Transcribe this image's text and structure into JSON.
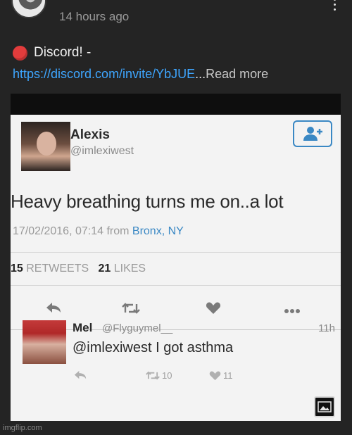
{
  "header": {
    "timestamp": "14 hours ago"
  },
  "description": {
    "discord_text": "Discord! -",
    "link_text": "https://discord.com/invite/YbJUE",
    "ellipsis": "...",
    "read_more": "Read more"
  },
  "tweet": {
    "name": "Alexis",
    "handle": "@imlexiwest",
    "text": "Heavy breathing turns me on..a lot",
    "date": "17/02/2016, 07:14 from",
    "place": "Bronx, NY",
    "retweets_count": "15",
    "retweets_label": "RETWEETS",
    "likes_count": "21",
    "likes_label": "LIKES"
  },
  "reply": {
    "name": "Mel",
    "handle": "@Flyguymel__",
    "time": "11h",
    "text": "@imlexiwest I got asthma",
    "retweets": "10",
    "likes": "11"
  },
  "footer": {
    "watermark": "imgflip.com"
  },
  "colors": {
    "background": "#242424",
    "link": "#3ea6ff",
    "red_dot": "#e23c3c",
    "twitter_blue": "#3a88c4"
  }
}
